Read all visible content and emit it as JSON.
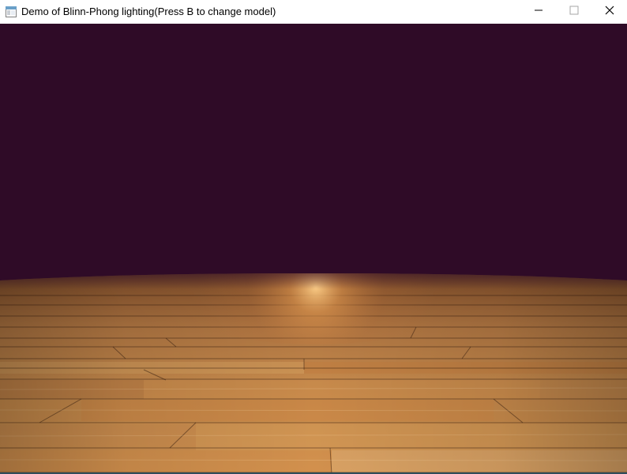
{
  "window": {
    "title": "Demo of Blinn-Phong lighting(Press B to change model)",
    "icons": {
      "app": "app-window-icon",
      "minimize": "minimize-icon",
      "maximize": "maximize-icon",
      "close": "close-icon"
    }
  },
  "scene": {
    "background_color": "#2f0b27",
    "floor_material": "wood-planks",
    "floor_base_color": "#c58a49",
    "highlight_color": "#ffb35a",
    "light_model_switch_key": "B"
  }
}
